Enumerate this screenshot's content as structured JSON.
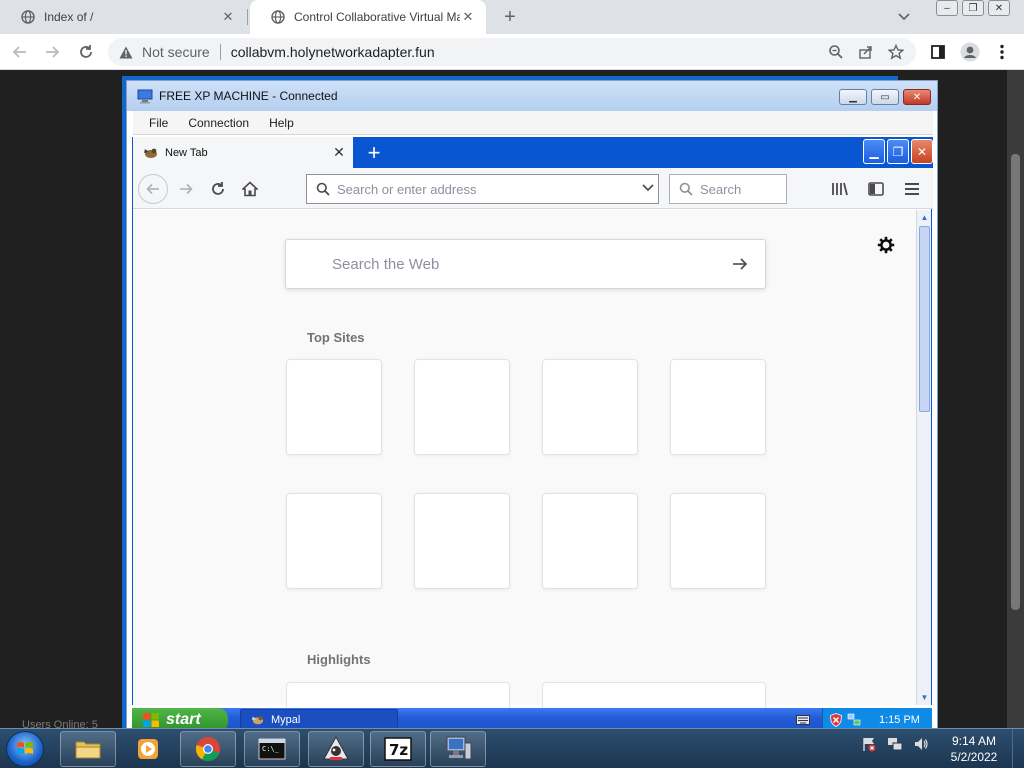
{
  "browser": {
    "tabs": [
      {
        "title": "Index of /"
      },
      {
        "title": "Control Collaborative Virtual Ma"
      }
    ],
    "address": {
      "security_label": "Not secure",
      "url": "collabvm.holynetworkadapter.fun"
    }
  },
  "page": {
    "users_online": "Users Online: 5"
  },
  "vm_window": {
    "title": "FREE XP MACHINE - Connected",
    "menu": [
      "File",
      "Connection",
      "Help"
    ]
  },
  "firefox": {
    "tab_title": "New Tab",
    "url_placeholder": "Search or enter address",
    "search_placeholder": "Search",
    "content": {
      "web_search_placeholder": "Search the Web",
      "top_sites_title": "Top Sites",
      "highlights_title": "Highlights"
    }
  },
  "xp_taskbar": {
    "start_label": "start",
    "task_label": "Mypal",
    "clock": "1:15 PM"
  },
  "host_taskbar": {
    "time": "9:14 AM",
    "date": "5/2/2022",
    "apps": [
      "file-explorer",
      "media-player",
      "chrome",
      "command-prompt",
      "java",
      "7zip",
      "network-computer"
    ]
  }
}
